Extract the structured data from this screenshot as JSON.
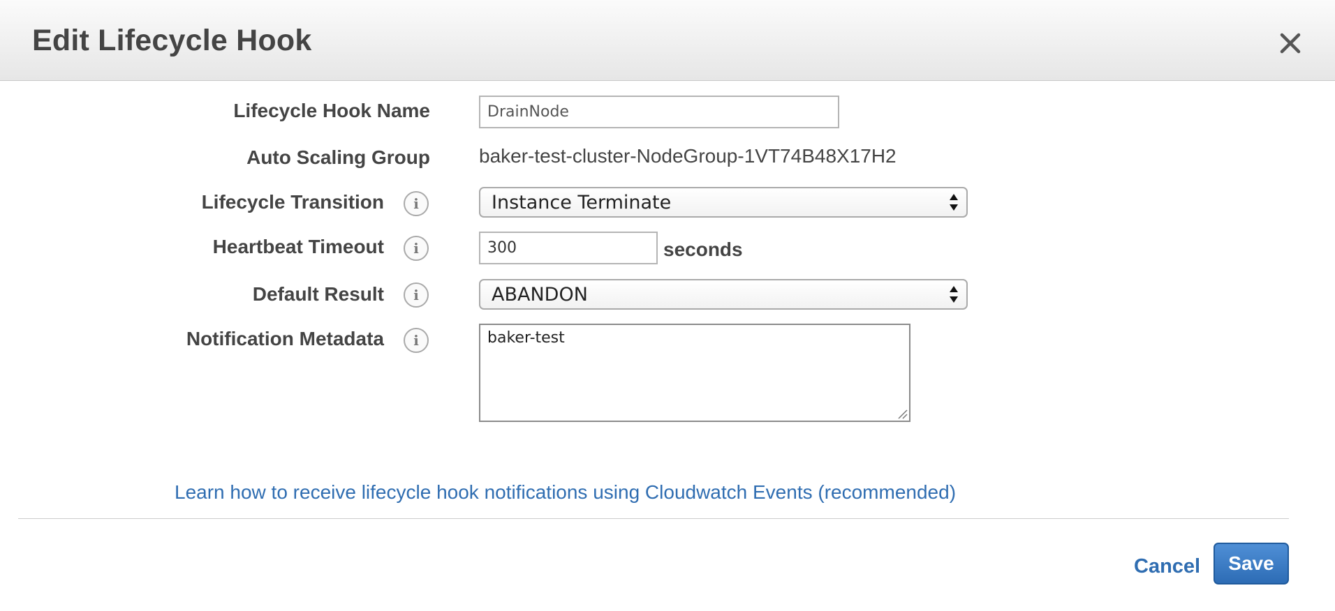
{
  "dialog": {
    "title": "Edit Lifecycle Hook"
  },
  "form": {
    "hook_name": {
      "label": "Lifecycle Hook Name",
      "value": "DrainNode"
    },
    "asg": {
      "label": "Auto Scaling Group",
      "value": "baker-test-cluster-NodeGroup-1VT74B48X17H2"
    },
    "transition": {
      "label": "Lifecycle Transition",
      "value": "Instance Terminate"
    },
    "heartbeat": {
      "label": "Heartbeat Timeout",
      "value": "300",
      "unit": "seconds"
    },
    "default_result": {
      "label": "Default Result",
      "value": "ABANDON"
    },
    "metadata": {
      "label": "Notification Metadata",
      "value": "baker-test"
    },
    "info_glyph": "i"
  },
  "footer": {
    "learn_link": "Learn how to receive lifecycle hook notifications using Cloudwatch Events (recommended)",
    "cancel_label": "Cancel",
    "save_label": "Save"
  },
  "colors": {
    "link": "#2f6db1",
    "primary_button": "#2d6cb5",
    "header_bg": "#e6e6e6"
  },
  "icons": {
    "close": "close-icon",
    "info": "info-icon",
    "select_arrows": "select-arrows-icon",
    "resize": "resize-grip-icon"
  }
}
